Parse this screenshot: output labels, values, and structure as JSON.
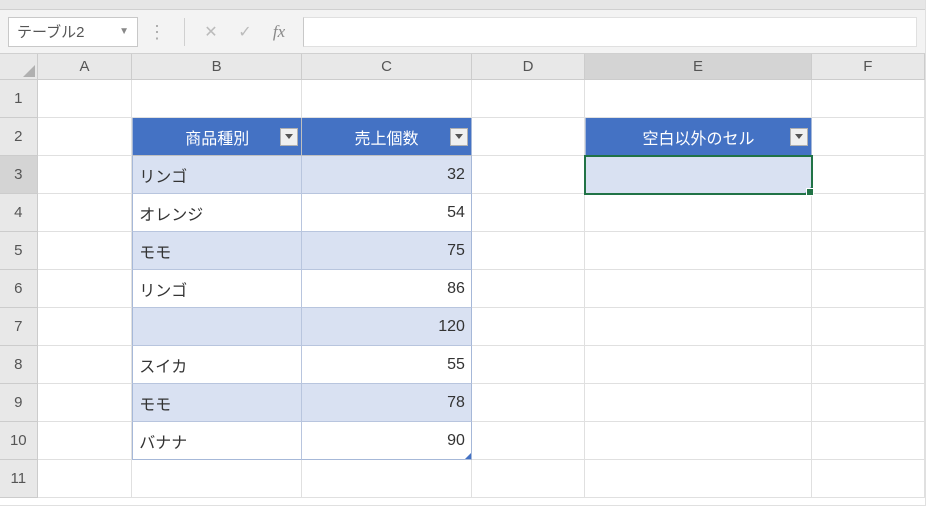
{
  "name_box": "テーブル2",
  "fx_label": "fx",
  "columns": [
    {
      "label": "A",
      "w": "wA",
      "active": false
    },
    {
      "label": "B",
      "w": "wB",
      "active": false
    },
    {
      "label": "C",
      "w": "wC",
      "active": false
    },
    {
      "label": "D",
      "w": "wD",
      "active": false
    },
    {
      "label": "E",
      "w": "wE",
      "active": true
    },
    {
      "label": "F",
      "w": "wF",
      "active": false
    }
  ],
  "row_labels": [
    "1",
    "2",
    "3",
    "4",
    "5",
    "6",
    "7",
    "8",
    "9",
    "10",
    "11"
  ],
  "active_row": "3",
  "table1": {
    "headers": {
      "b": "商品種別",
      "c": "売上個数"
    },
    "rows": [
      {
        "b": "リンゴ",
        "c": "32"
      },
      {
        "b": "オレンジ",
        "c": "54"
      },
      {
        "b": "モモ",
        "c": "75"
      },
      {
        "b": "リンゴ",
        "c": "86"
      },
      {
        "b": "",
        "c": "120"
      },
      {
        "b": "スイカ",
        "c": "55"
      },
      {
        "b": "モモ",
        "c": "78"
      },
      {
        "b": "バナナ",
        "c": "90"
      }
    ]
  },
  "table2": {
    "header": "空白以外のセル",
    "value": ""
  }
}
